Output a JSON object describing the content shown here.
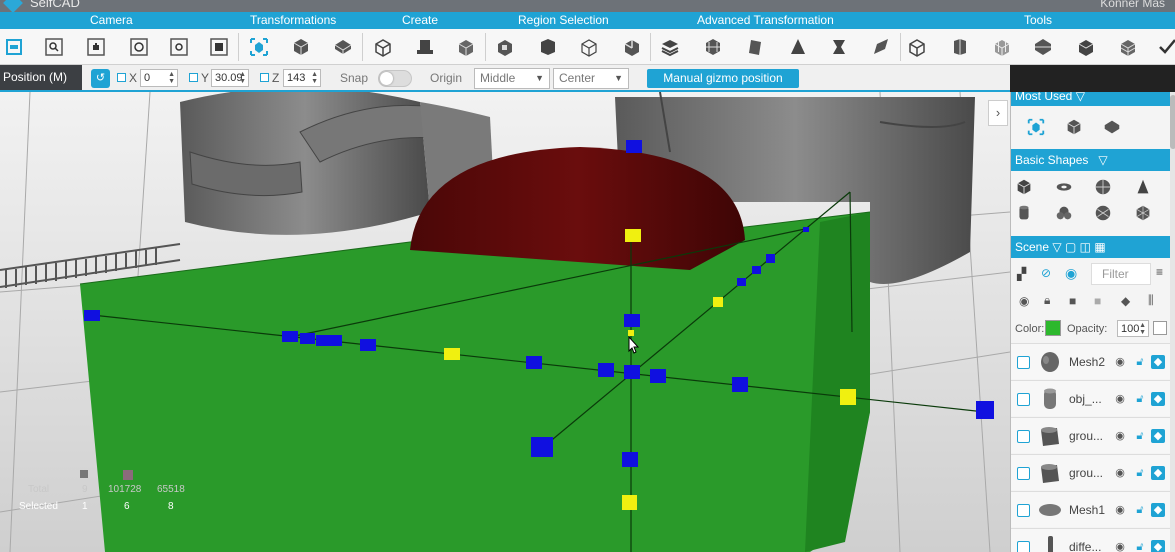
{
  "app": {
    "name": "SelfCAD",
    "user_partial": "Konner Mas"
  },
  "categories": [
    {
      "label": "Camera"
    },
    {
      "label": "Transformations"
    },
    {
      "label": "Create"
    },
    {
      "label": "Region Selection"
    },
    {
      "label": "Advanced Transformation"
    },
    {
      "label": "Tools"
    }
  ],
  "position_bar": {
    "label": "Position (M)",
    "x_label": "X",
    "x_value": "0",
    "y_label": "Y",
    "y_value": "30.09",
    "z_label": "Z",
    "z_value": "143",
    "snap_label": "Snap",
    "origin_label": "Origin",
    "origin_vertical": "Middle",
    "origin_horizontal": "Center",
    "gizmo_button": "Manual gizmo position"
  },
  "viewport": {
    "box_color": "#2a9a2a",
    "dome_color": "#5e0a0a",
    "handle_color": "#1010e0",
    "point_color": "#f0f010",
    "stats": {
      "total_label": "Total",
      "selected_label": "Selected",
      "total_values": [
        "9",
        "101728",
        "65518"
      ],
      "selected_values": [
        "1",
        "6",
        "8"
      ]
    }
  },
  "panel": {
    "most_used_label": "Most Used",
    "basic_shapes_label": "Basic Shapes",
    "scene_label": "Scene",
    "filter_placeholder": "Filter",
    "color_label": "Color:",
    "color_value": "#2db82d",
    "opacity_label": "Opacity:",
    "opacity_value": "100",
    "objects": [
      {
        "name": "Mesh2",
        "thumb": "head"
      },
      {
        "name": "obj_...",
        "thumb": "cylinder"
      },
      {
        "name": "grou...",
        "thumb": "pot"
      },
      {
        "name": "grou...",
        "thumb": "pot"
      },
      {
        "name": "Mesh1",
        "thumb": "disc"
      },
      {
        "name": "diffe...",
        "thumb": "peg"
      }
    ]
  }
}
